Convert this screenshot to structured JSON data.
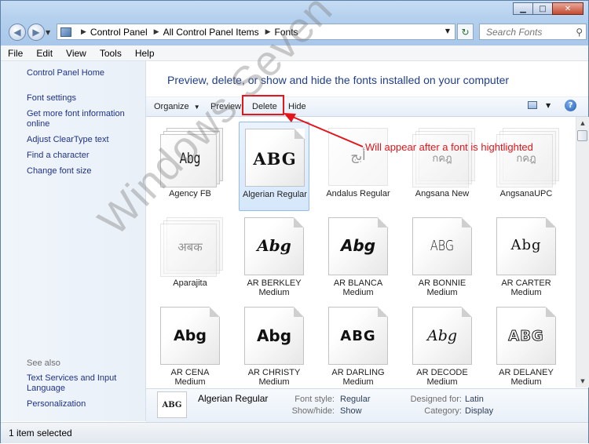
{
  "address": {
    "crumbs": [
      "Control Panel",
      "All Control Panel Items",
      "Fonts"
    ],
    "search_placeholder": "Search Fonts"
  },
  "menu": [
    "File",
    "Edit",
    "View",
    "Tools",
    "Help"
  ],
  "sidebar": {
    "items": [
      {
        "label": "Control Panel Home"
      },
      {
        "label": "Font settings"
      },
      {
        "label": "Get more font information online"
      },
      {
        "label": "Adjust ClearType text"
      },
      {
        "label": "Find a character"
      },
      {
        "label": "Change font size"
      }
    ],
    "see_also_label": "See also",
    "see_also": [
      {
        "label": "Text Services and Input Language"
      },
      {
        "label": "Personalization"
      }
    ]
  },
  "header": "Preview, delete, or show and hide the fonts installed on your computer",
  "commands": {
    "organize": "Organize",
    "preview": "Preview",
    "delete": "Delete",
    "hide": "Hide"
  },
  "annotation": "Will appear after a font is hightlighted",
  "watermark": "Windows Seven Forums",
  "fonts": [
    {
      "name": "Agency FB",
      "sample": "Abg",
      "stack": true
    },
    {
      "name": "Algerian Regular",
      "sample": "ABG",
      "selected": true
    },
    {
      "name": "Andalus Regular",
      "sample": "أبج",
      "faded": true
    },
    {
      "name": "Angsana New",
      "sample": "กคฎ",
      "stack": true,
      "faded": true
    },
    {
      "name": "AngsanaUPC",
      "sample": "กคฎ",
      "stack": true,
      "faded": true
    },
    {
      "name": "Aparajita",
      "sample": "अबक",
      "stack": true,
      "faded": true
    },
    {
      "name": "AR BERKLEY Medium",
      "sample": "Abg"
    },
    {
      "name": "AR BLANCA Medium",
      "sample": "Abg"
    },
    {
      "name": "AR BONNIE Medium",
      "sample": "ABG"
    },
    {
      "name": "AR CARTER Medium",
      "sample": "Abg"
    },
    {
      "name": "AR CENA Medium",
      "sample": "Abg"
    },
    {
      "name": "AR CHRISTY Medium",
      "sample": "Abg"
    },
    {
      "name": "AR DARLING Medium",
      "sample": "ABG"
    },
    {
      "name": "AR DECODE Medium",
      "sample": "Abg"
    },
    {
      "name": "AR DELANEY Medium",
      "sample": "ABG"
    }
  ],
  "details": {
    "thumb": "ABG",
    "name": "Algerian Regular",
    "font_style_label": "Font style:",
    "font_style": "Regular",
    "show_hide_label": "Show/hide:",
    "show_hide": "Show",
    "designed_for_label": "Designed for:",
    "designed_for": "Latin",
    "category_label": "Category:",
    "category": "Display"
  },
  "status": "1 item selected"
}
